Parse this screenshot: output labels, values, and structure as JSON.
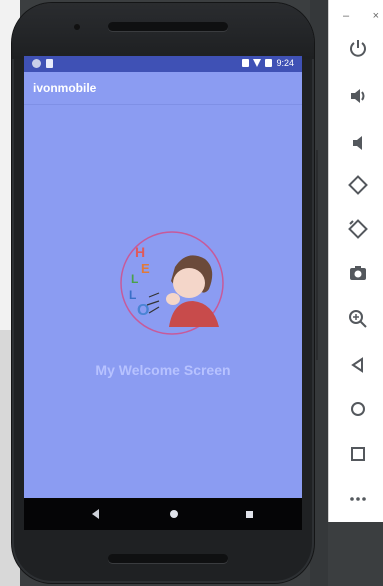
{
  "status_bar": {
    "time": "9:24"
  },
  "app": {
    "title": "ivonmobile"
  },
  "main": {
    "welcome_text": "My Welcome Screen"
  },
  "logo": {
    "letters": [
      "H",
      "E",
      "L",
      "L",
      "O"
    ]
  },
  "emulator_window": {
    "minimize_label": "–",
    "close_label": "×"
  },
  "emulator_tools": [
    "power-icon",
    "volume-up-icon",
    "volume-down-icon",
    "rotate-left-icon",
    "rotate-right-icon",
    "camera-icon",
    "zoom-icon",
    "back-icon",
    "home-icon",
    "overview-icon",
    "more-icon"
  ],
  "colors": {
    "screen_bg": "#8b9cf2",
    "status_bar": "#3f51b5",
    "nav_bar": "#050506",
    "tool_icon": "#54585d"
  }
}
